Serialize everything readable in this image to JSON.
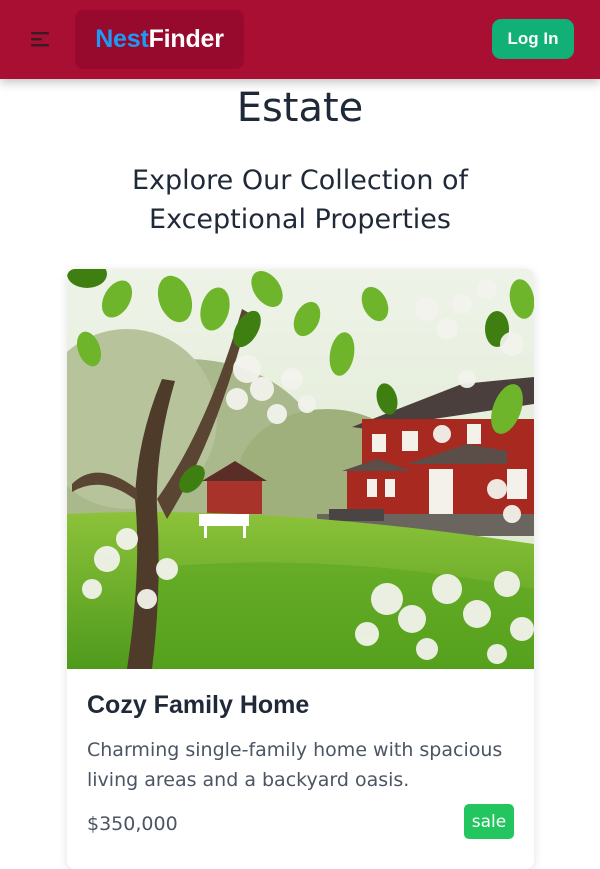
{
  "navbar": {
    "menu_icon": "menu-icon",
    "brand_part1": "Nest",
    "brand_part2": "Finder",
    "login_label": "Log In",
    "colors": {
      "bar": "#a90e33",
      "brand_bg": "#980a2d",
      "brand_accent": "#1e9af5",
      "login_bg": "#10b076"
    }
  },
  "hero": {
    "title": "Estate",
    "subtitle": "Explore Our Collection of Exceptional Properties"
  },
  "listing": {
    "title": "Cozy Family Home",
    "description": "Charming single-family home with spacious living areas and a backyard oasis.",
    "price": "$350,000",
    "badge": "sale",
    "badge_color": "#22c55e"
  }
}
